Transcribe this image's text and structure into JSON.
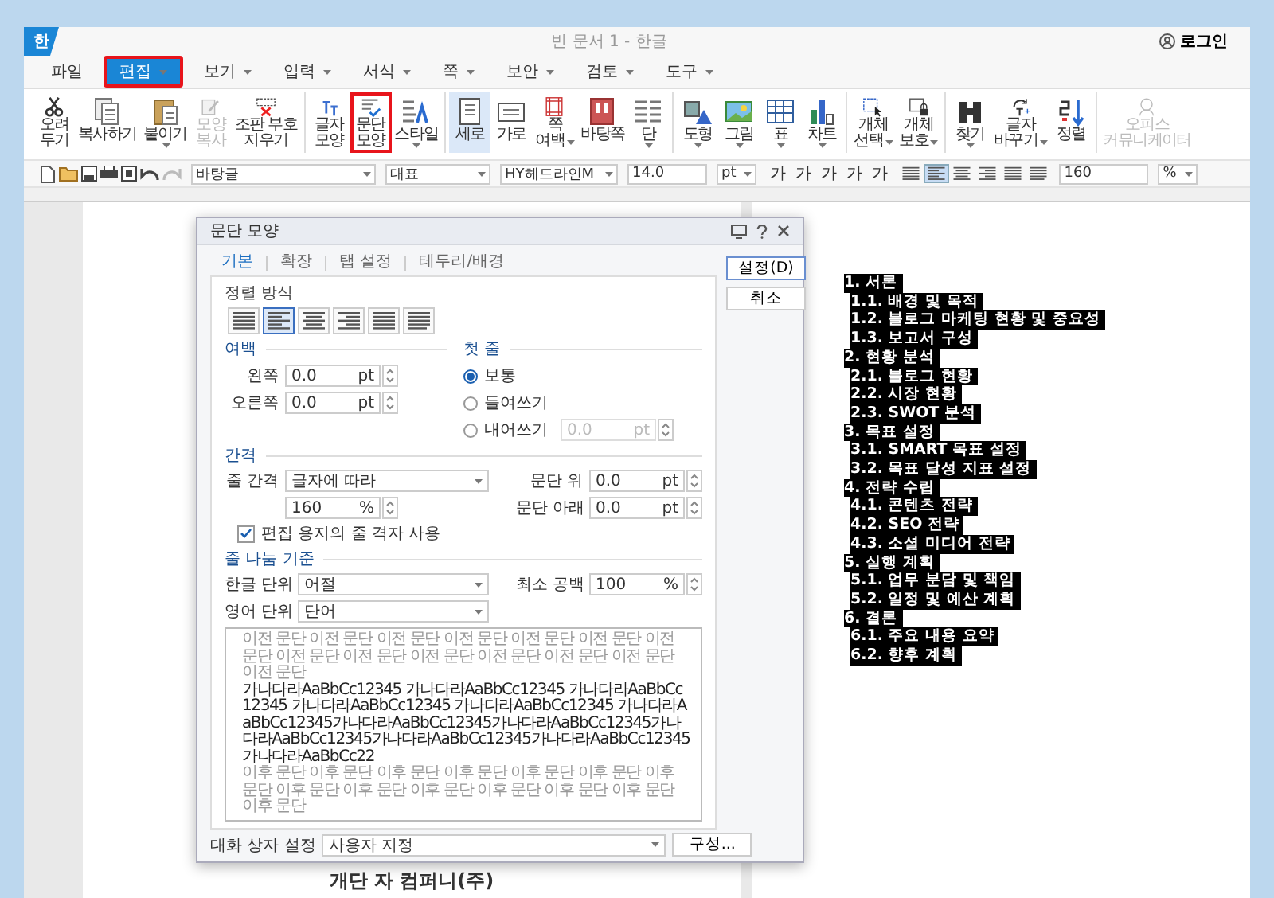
{
  "window": {
    "app_icon": "한",
    "title": "빈 문서 1 - 한글",
    "login": "로그인"
  },
  "menu": [
    {
      "label": "파일",
      "selected": false,
      "dropdown": false,
      "highlighted": false
    },
    {
      "label": "편집",
      "selected": true,
      "dropdown": true,
      "highlighted": true
    },
    {
      "label": "보기",
      "selected": false,
      "dropdown": true,
      "highlighted": false
    },
    {
      "label": "입력",
      "selected": false,
      "dropdown": true,
      "highlighted": false
    },
    {
      "label": "서식",
      "selected": false,
      "dropdown": true,
      "highlighted": false
    },
    {
      "label": "쪽",
      "selected": false,
      "dropdown": true,
      "highlighted": false
    },
    {
      "label": "보안",
      "selected": false,
      "dropdown": true,
      "highlighted": false
    },
    {
      "label": "검토",
      "selected": false,
      "dropdown": true,
      "highlighted": false
    },
    {
      "label": "도구",
      "selected": false,
      "dropdown": true,
      "highlighted": false
    }
  ],
  "ribbon": [
    [
      {
        "lines": [
          "오려",
          "두기"
        ],
        "dropdown": false,
        "disabled": false,
        "selected": false,
        "highlighted": false
      },
      {
        "lines": [
          "복사하기"
        ],
        "dropdown": false,
        "disabled": false,
        "selected": false,
        "highlighted": false
      },
      {
        "lines": [
          "붙이기"
        ],
        "dropdown": true,
        "disabled": false,
        "selected": false,
        "highlighted": false
      },
      {
        "lines": [
          "모양",
          "복사"
        ],
        "dropdown": false,
        "disabled": true,
        "selected": false,
        "highlighted": false
      },
      {
        "lines": [
          "조판 부호",
          "지우기"
        ],
        "dropdown": false,
        "disabled": false,
        "selected": false,
        "highlighted": false
      }
    ],
    [
      {
        "lines": [
          "글자",
          "모양"
        ],
        "dropdown": false,
        "disabled": false,
        "selected": false,
        "highlighted": false
      },
      {
        "lines": [
          "문단",
          "모양"
        ],
        "dropdown": false,
        "disabled": false,
        "selected": false,
        "highlighted": true
      },
      {
        "lines": [
          "스타일"
        ],
        "dropdown": true,
        "disabled": false,
        "selected": false,
        "highlighted": false
      }
    ],
    [
      {
        "lines": [
          "세로"
        ],
        "dropdown": false,
        "disabled": false,
        "selected": true,
        "highlighted": false
      },
      {
        "lines": [
          "가로"
        ],
        "dropdown": false,
        "disabled": false,
        "selected": false,
        "highlighted": false
      },
      {
        "lines": [
          "쪽",
          "여백"
        ],
        "dropdown": true,
        "disabled": false,
        "selected": false,
        "highlighted": false
      },
      {
        "lines": [
          "바탕쪽"
        ],
        "dropdown": false,
        "disabled": false,
        "selected": false,
        "highlighted": false
      },
      {
        "lines": [
          "단"
        ],
        "dropdown": true,
        "disabled": false,
        "selected": false,
        "highlighted": false
      }
    ],
    [
      {
        "lines": [
          "도형"
        ],
        "dropdown": true,
        "disabled": false,
        "selected": false,
        "highlighted": false
      },
      {
        "lines": [
          "그림"
        ],
        "dropdown": true,
        "disabled": false,
        "selected": false,
        "highlighted": false
      },
      {
        "lines": [
          "표"
        ],
        "dropdown": true,
        "disabled": false,
        "selected": false,
        "highlighted": false
      },
      {
        "lines": [
          "차트"
        ],
        "dropdown": true,
        "disabled": false,
        "selected": false,
        "highlighted": false
      }
    ],
    [
      {
        "lines": [
          "개체",
          "선택"
        ],
        "dropdown": true,
        "disabled": false,
        "selected": false,
        "highlighted": false
      },
      {
        "lines": [
          "개체",
          "보호"
        ],
        "dropdown": true,
        "disabled": false,
        "selected": false,
        "highlighted": false
      }
    ],
    [
      {
        "lines": [
          "찾기"
        ],
        "dropdown": true,
        "disabled": false,
        "selected": false,
        "highlighted": false
      },
      {
        "lines": [
          "글자",
          "바꾸기"
        ],
        "dropdown": true,
        "disabled": false,
        "selected": false,
        "highlighted": false
      },
      {
        "lines": [
          "정렬"
        ],
        "dropdown": false,
        "disabled": false,
        "selected": false,
        "highlighted": false
      }
    ],
    [
      {
        "lines": [
          "오피스",
          "커뮤니케이터"
        ],
        "dropdown": false,
        "disabled": true,
        "selected": false,
        "highlighted": false
      }
    ]
  ],
  "format_bar": {
    "style": "바탕글",
    "lang": "대표",
    "font": "HY헤드라인M",
    "size": "14.0",
    "size_unit": "pt",
    "char_buttons": [
      "가",
      "가",
      "가",
      "가",
      "가"
    ],
    "align": [
      {
        "selected": false
      },
      {
        "selected": true
      },
      {
        "selected": false
      },
      {
        "selected": false
      },
      {
        "selected": false
      },
      {
        "selected": false
      }
    ],
    "zoom": "160",
    "zoom_unit": "%"
  },
  "left_page": {
    "footer_text": "개단 자 컴퍼니(주)"
  },
  "dialog": {
    "title": "문단 모양",
    "tabs": [
      {
        "label": "기본",
        "selected": true
      },
      {
        "label": "확장",
        "selected": false
      },
      {
        "label": "탭 설정",
        "selected": false
      },
      {
        "label": "테두리/배경",
        "selected": false
      }
    ],
    "buttons": [
      "설정(D)",
      "취소"
    ],
    "align_section": {
      "title": "정렬 방식",
      "options": [
        {
          "selected": false
        },
        {
          "selected": true
        },
        {
          "selected": false
        },
        {
          "selected": false
        },
        {
          "selected": false
        },
        {
          "selected": false
        }
      ]
    },
    "margin_section": {
      "title": "여백",
      "fields": [
        {
          "label": "왼쪽",
          "value": "0.0",
          "unit": "pt"
        },
        {
          "label": "오른쪽",
          "value": "0.0",
          "unit": "pt"
        }
      ]
    },
    "first_line": {
      "title": "첫 줄",
      "options": [
        {
          "label": "보통",
          "selected": true
        },
        {
          "label": "들여쓰기",
          "selected": false
        },
        {
          "label": "내어쓰기",
          "selected": false
        }
      ],
      "value": "0.0",
      "unit": "pt",
      "disabled": true
    },
    "spacing": {
      "title": "간격",
      "line_spacing_label": "줄 간격",
      "line_spacing_type": "글자에 따라",
      "line_spacing_value": "160",
      "line_spacing_unit": "%",
      "above_label": "문단 위",
      "above_value": "0.0",
      "above_unit": "pt",
      "below_label": "문단 아래",
      "below_value": "0.0",
      "below_unit": "pt",
      "grid_checkbox": {
        "label": "편집 용지의 줄 격자 사용",
        "checked": true
      }
    },
    "line_break": {
      "title": "줄 나눔 기준",
      "korean_label": "한글 단위",
      "korean_value": "어절",
      "english_label": "영어 단위",
      "english_value": "단어",
      "min_space_label": "최소 공백",
      "min_space_value": "100",
      "min_space_unit": "%"
    },
    "preview": {
      "before": "이전 문단 이전 문단 이전 문단 이전 문단 이전 문단 이전 문단 이전 문단 이전 문단 이전 문단 이전 문단 이전 문단 이전 문단 이전 문단 이전 문단",
      "sample": "가나다라AaBbCc12345 가나다라AaBbCc12345 가나다라AaBbCc12345 가나다라AaBbCc12345 가나다라AaBbCc12345 가나다라AaBbCc12345가나다라AaBbCc12345가나다라AaBbCc12345가나다라AaBbCc12345가나다라AaBbCc12345가나다라AaBbCc12345가나다라AaBbCc22",
      "after": "이후 문단 이후 문단 이후 문단 이후 문단 이후 문단 이후 문단 이후 문단 이후 문단 이후 문단 이후 문단 이후 문단 이후 문단 이후 문단 이후 문단"
    },
    "settings_label": "대화 상자 설정",
    "settings_value": "사용자 지정",
    "configure_button": "구성..."
  },
  "outline": {
    "selected": true,
    "items": [
      {
        "label": "1. 서론",
        "children": [
          {
            "label": "1.1. 배경 및 목적"
          },
          {
            "label": "1.2. 블로그 마케팅 현황 및 중요성"
          },
          {
            "label": "1.3. 보고서 구성"
          }
        ]
      },
      {
        "label": "2. 현황 분석",
        "children": [
          {
            "label": "2.1. 블로그 현황"
          },
          {
            "label": "2.2. 시장 현황"
          },
          {
            "label": "2.3. SWOT 분석"
          }
        ]
      },
      {
        "label": "3. 목표 설정",
        "children": [
          {
            "label": "3.1. SMART 목표 설정"
          },
          {
            "label": "3.2. 목표 달성 지표 설정"
          }
        ]
      },
      {
        "label": "4. 전략 수립",
        "children": [
          {
            "label": "4.1. 콘텐츠 전략"
          },
          {
            "label": "4.2. SEO 전략"
          },
          {
            "label": "4.3. 소셜 미디어 전략"
          }
        ]
      },
      {
        "label": "5. 실행 계획",
        "children": [
          {
            "label": "5.1. 업무 분담 및 책임"
          },
          {
            "label": "5.2. 일정 및 예산 계획"
          }
        ]
      },
      {
        "label": "6. 결론",
        "children": [
          {
            "label": "6.1. 주요 내용 요약"
          },
          {
            "label": "6.2. 향후 계획"
          }
        ]
      }
    ]
  }
}
